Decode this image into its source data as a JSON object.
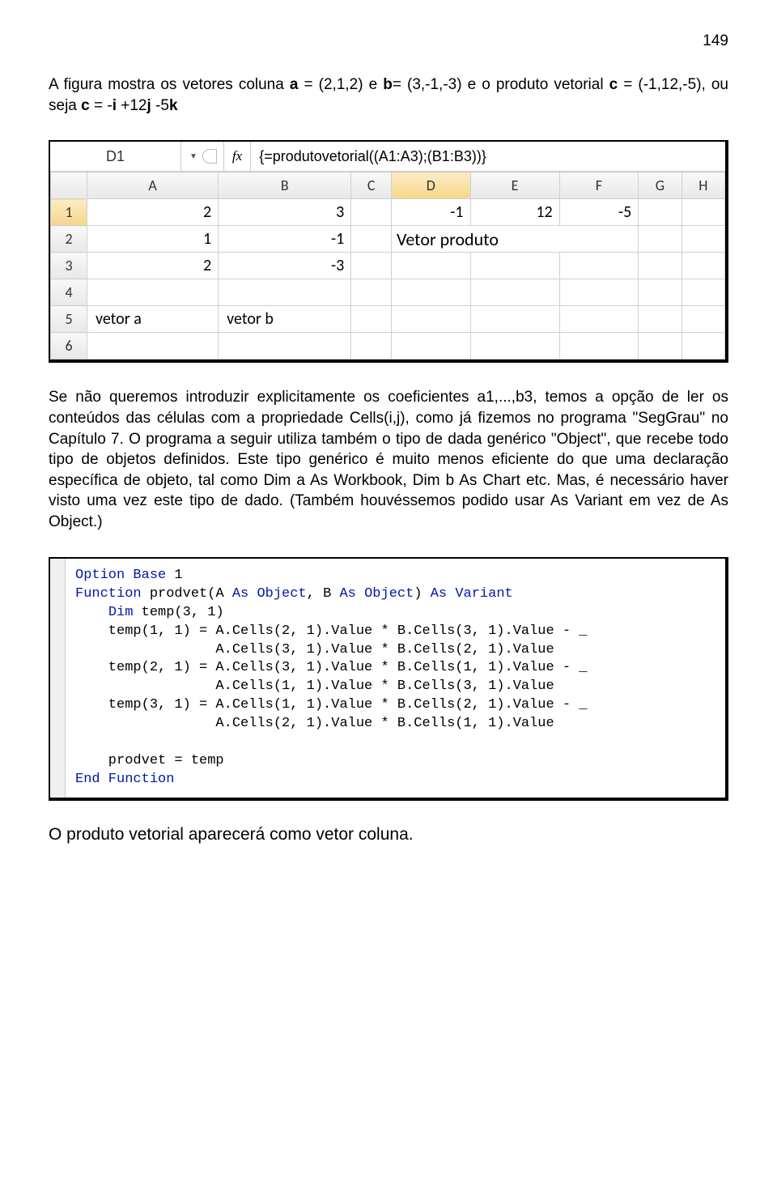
{
  "page_number": "149",
  "intro_para_html": "A figura mostra os vetores coluna <b>a</b> = (2,1,2) e <b>b</b>= (3,-1,-3) e o produto vetorial <b>c</b> = (-1,12,-5), ou seja <b>c</b> = -<b>i</b> +12<b>j</b> -5<b>k</b>",
  "excel": {
    "name_box": "D1",
    "fx_label": "fx",
    "formula": "{=produtovetorial((A1:A3);(B1:B3))}",
    "col_headers": [
      "A",
      "B",
      "C",
      "D",
      "E",
      "F",
      "G",
      "H"
    ],
    "rows": [
      {
        "n": "1",
        "cells": [
          "2",
          "3",
          "",
          "-1",
          "12",
          "-5",
          "",
          ""
        ]
      },
      {
        "n": "2",
        "cells": [
          "1",
          "-1",
          "",
          "Vetor produto",
          "",
          "",
          "",
          ""
        ],
        "merge_d": 3
      },
      {
        "n": "3",
        "cells": [
          "2",
          "-3",
          "",
          "",
          "",
          "",
          "",
          ""
        ]
      },
      {
        "n": "4",
        "cells": [
          "",
          "",
          "",
          "",
          "",
          "",
          "",
          ""
        ]
      },
      {
        "n": "5",
        "cells": [
          "vetor a",
          "vetor b",
          "",
          "",
          "",
          "",
          "",
          ""
        ]
      },
      {
        "n": "6",
        "cells": [
          "",
          "",
          "",
          "",
          "",
          "",
          "",
          ""
        ]
      }
    ]
  },
  "body_para": "Se não queremos introduzir explicitamente os coeficientes a1,...,b3, temos a opção de ler os conteúdos das células com a propriedade Cells(i,j), como já fizemos no programa \"SegGrau\" no Capítulo 7. O programa a seguir utiliza também o tipo de dada genérico \"Object\", que recebe todo tipo de objetos definidos. Este tipo genérico é muito menos eficiente do que uma declaração específica de objeto, tal como Dim a As Workbook, Dim b As Chart etc. Mas, é necessário haver visto uma vez este tipo de dado. (Também houvéssemos podido usar As Variant em vez de As Object.)",
  "code": {
    "lines": [
      {
        "t": "<kw>Option Base</kw> 1"
      },
      {
        "t": "<kw>Function</kw> prodvet(A <kw>As</kw> <kw>Object</kw>, B <kw>As</kw> <kw>Object</kw>) <kw>As</kw> <kw>Variant</kw>"
      },
      {
        "t": "    <kw>Dim</kw> temp(3, 1)"
      },
      {
        "t": "    temp(1, 1) = A.Cells(2, 1).Value * B.Cells(3, 1).Value - _"
      },
      {
        "t": "                 A.Cells(3, 1).Value * B.Cells(2, 1).Value"
      },
      {
        "t": "    temp(2, 1) = A.Cells(3, 1).Value * B.Cells(1, 1).Value - _"
      },
      {
        "t": "                 A.Cells(1, 1).Value * B.Cells(3, 1).Value"
      },
      {
        "t": "    temp(3, 1) = A.Cells(1, 1).Value * B.Cells(2, 1).Value - _"
      },
      {
        "t": "                 A.Cells(2, 1).Value * B.Cells(1, 1).Value"
      },
      {
        "t": ""
      },
      {
        "t": "    prodvet = temp"
      },
      {
        "t": "<kw>End Function</kw>"
      }
    ]
  },
  "closing": "O produto vetorial aparecerá como vetor coluna."
}
